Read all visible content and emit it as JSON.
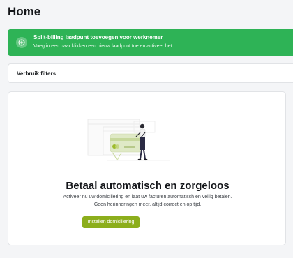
{
  "page": {
    "title": "Home"
  },
  "banner": {
    "icon": "plus-circle-icon",
    "title": "Split-billing laadpunt toevoegen voor werknemer",
    "description": "Voeg in een paar klikken een nieuw laadpunt toe en activeer het.",
    "color": "#2eb356"
  },
  "filters": {
    "label": "Verbruik filters"
  },
  "card": {
    "illustration": "person-holding-credit-card-illustration",
    "heading": "Betaal automatisch en zorgeloos",
    "text_line1": "Activeer nu uw domiciliëring en laat uw facturen automatisch en veilig betalen.",
    "text_line2": "Geen herinneringen meer, altijd correct en op tijd.",
    "button_label": "Instellen domiciliëring",
    "button_color": "#8cae1c"
  }
}
